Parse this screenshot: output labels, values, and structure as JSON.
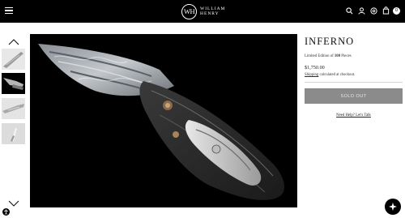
{
  "header": {
    "logo_mark": "WH",
    "logo_line1": "WILLIAM",
    "logo_line2": "HENRY",
    "cart_count": "0",
    "icons": [
      "menu-icon",
      "search-icon",
      "user-icon",
      "location-icon",
      "cart-icon"
    ]
  },
  "gallery": {
    "thumbnail_count": 4,
    "active_index": 1
  },
  "product": {
    "title": "INFERNO",
    "edition_prefix": "Limited Edition of ",
    "edition_count": "100",
    "edition_suffix": " Pieces",
    "price": "$1,750.00",
    "shipping_link": "Shipping",
    "shipping_text": " calculated at checkout.",
    "sold_out_label": "SOLD OUT",
    "help_link": "Need Help? Let's Talk"
  },
  "colors": {
    "header_bg": "#000000",
    "button_bg": "#8b8b8b",
    "page_bg": "#ffffff"
  }
}
